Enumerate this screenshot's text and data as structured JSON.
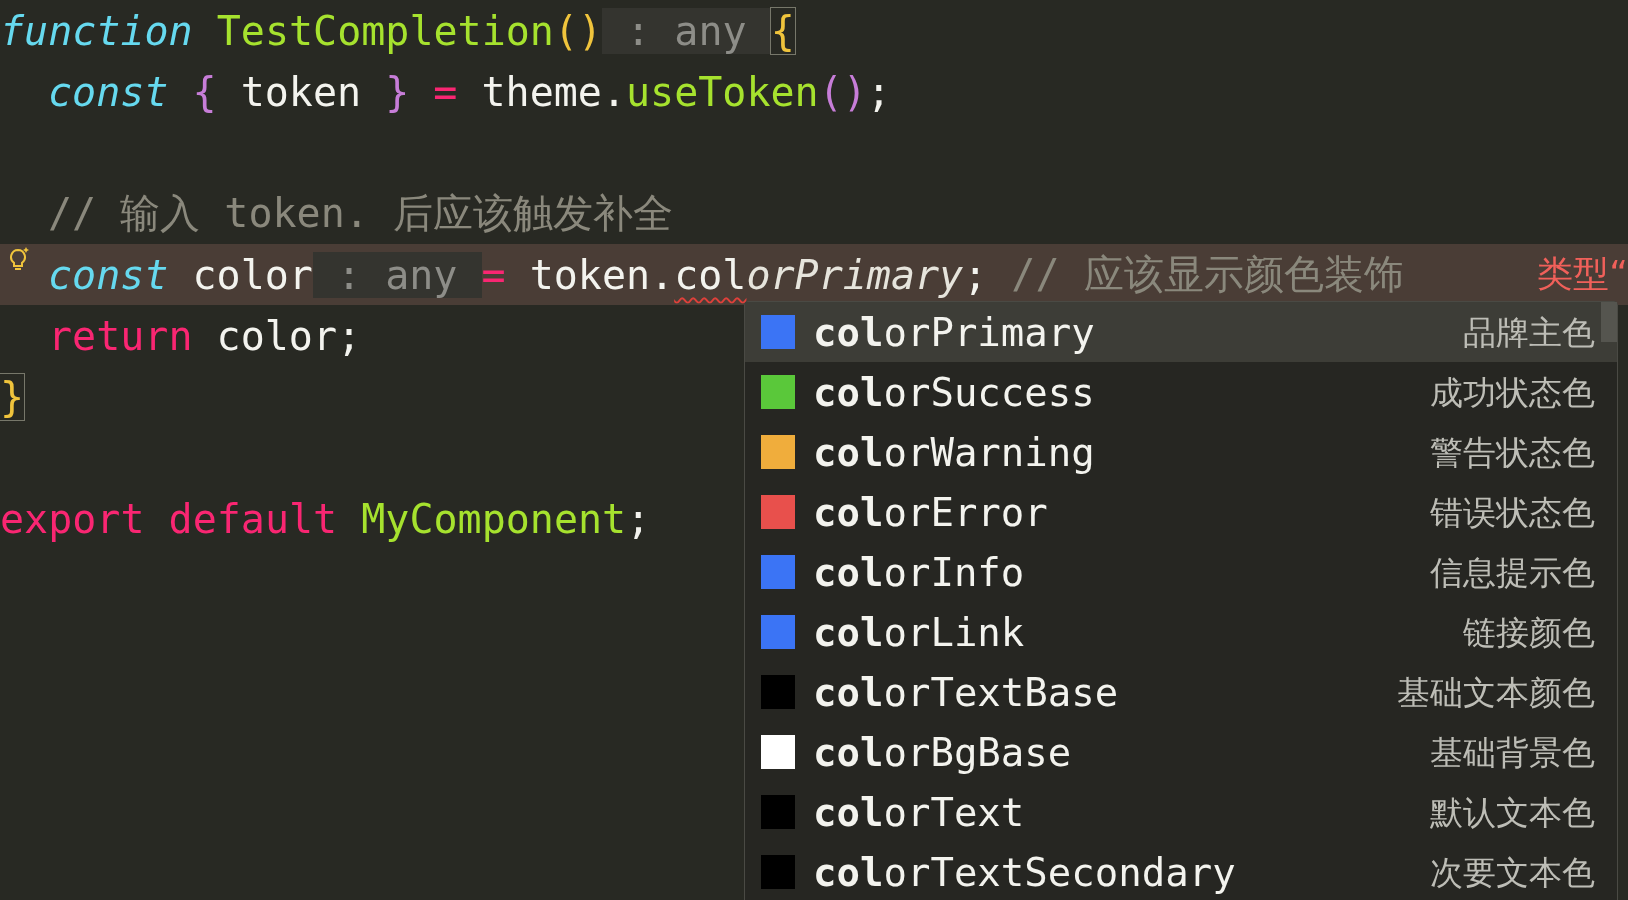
{
  "editor": {
    "lines": [
      {
        "kind": "code",
        "current": false,
        "indented": false,
        "tokens": [
          {
            "text": "function",
            "kind": "keyword"
          },
          {
            "text": " TestCompletion",
            "kind": "fn"
          },
          {
            "text": "()",
            "kind": "paren"
          },
          {
            "text": " : any ",
            "kind": "hint"
          },
          {
            "text": "{",
            "kind": "brace-match"
          }
        ]
      },
      {
        "kind": "code",
        "current": false,
        "indented": true,
        "tokens": [
          {
            "text": "const",
            "kind": "keyword"
          },
          {
            "text": " {",
            "kind": "brace"
          },
          {
            "text": " token ",
            "kind": "plain"
          },
          {
            "text": "}",
            "kind": "brace"
          },
          {
            "text": " =",
            "kind": "operator"
          },
          {
            "text": " theme.",
            "kind": "plain"
          },
          {
            "text": "useToken",
            "kind": "fn"
          },
          {
            "text": "()",
            "kind": "brace"
          },
          {
            "text": ";",
            "kind": "plain"
          }
        ]
      },
      {
        "kind": "blank",
        "current": false
      },
      {
        "kind": "code",
        "current": false,
        "indented": true,
        "tokens": [
          {
            "text": "// 输入 token. 后应该触发补全",
            "kind": "comment"
          }
        ]
      },
      {
        "kind": "code",
        "current": true,
        "indented": true,
        "tokens": [
          {
            "text": "const",
            "kind": "keyword"
          },
          {
            "text": " color",
            "kind": "plain"
          },
          {
            "text": " : any ",
            "kind": "hint"
          },
          {
            "text": "=",
            "kind": "operator"
          },
          {
            "text": " token.",
            "kind": "plain"
          },
          {
            "text": "col",
            "kind": "squiggle"
          },
          {
            "text": "orPrimary",
            "kind": "ghost"
          },
          {
            "text": ";",
            "kind": "plain"
          },
          {
            "text": " // 应该显示颜色装饰",
            "kind": "comment"
          },
          {
            "text": "类型“",
            "kind": "error"
          }
        ]
      },
      {
        "kind": "code",
        "current": false,
        "indented": true,
        "tokens": [
          {
            "text": "return",
            "kind": "control"
          },
          {
            "text": " color;",
            "kind": "plain"
          }
        ]
      },
      {
        "kind": "code",
        "current": false,
        "indented": false,
        "tokens": [
          {
            "text": "}",
            "kind": "brace-match"
          }
        ]
      },
      {
        "kind": "blank",
        "current": false
      },
      {
        "kind": "code",
        "current": false,
        "indented": false,
        "tokens": [
          {
            "text": "export default",
            "kind": "control"
          },
          {
            "text": " MyComponent",
            "kind": "fn"
          },
          {
            "text": ";",
            "kind": "plain"
          }
        ]
      }
    ]
  },
  "suggestions": [
    {
      "label": "**col**orPrimary",
      "detail": "品牌主色",
      "color": "#3b74f5",
      "selected": true
    },
    {
      "label": "**col**orSuccess",
      "detail": "成功状态色",
      "color": "#5ac83a",
      "selected": false
    },
    {
      "label": "**col**orWarning",
      "detail": "警告状态色",
      "color": "#f0ad3c",
      "selected": false
    },
    {
      "label": "**col**orError",
      "detail": "错误状态色",
      "color": "#e8504c",
      "selected": false
    },
    {
      "label": "**col**orInfo",
      "detail": "信息提示色",
      "color": "#3b74f5",
      "selected": false
    },
    {
      "label": "**col**orLink",
      "detail": "链接颜色",
      "color": "#3b74f5",
      "selected": false
    },
    {
      "label": "**col**orTextBase",
      "detail": "基础文本颜色",
      "color": "#000000",
      "selected": false
    },
    {
      "label": "**col**orBgBase",
      "detail": "基础背景色",
      "color": "#ffffff",
      "selected": false
    },
    {
      "label": "**col**orText",
      "detail": "默认文本色",
      "color": "#000000",
      "selected": false
    },
    {
      "label": "**col**orTextSecondary",
      "detail": "次要文本色",
      "color": "#000000",
      "selected": false
    }
  ]
}
